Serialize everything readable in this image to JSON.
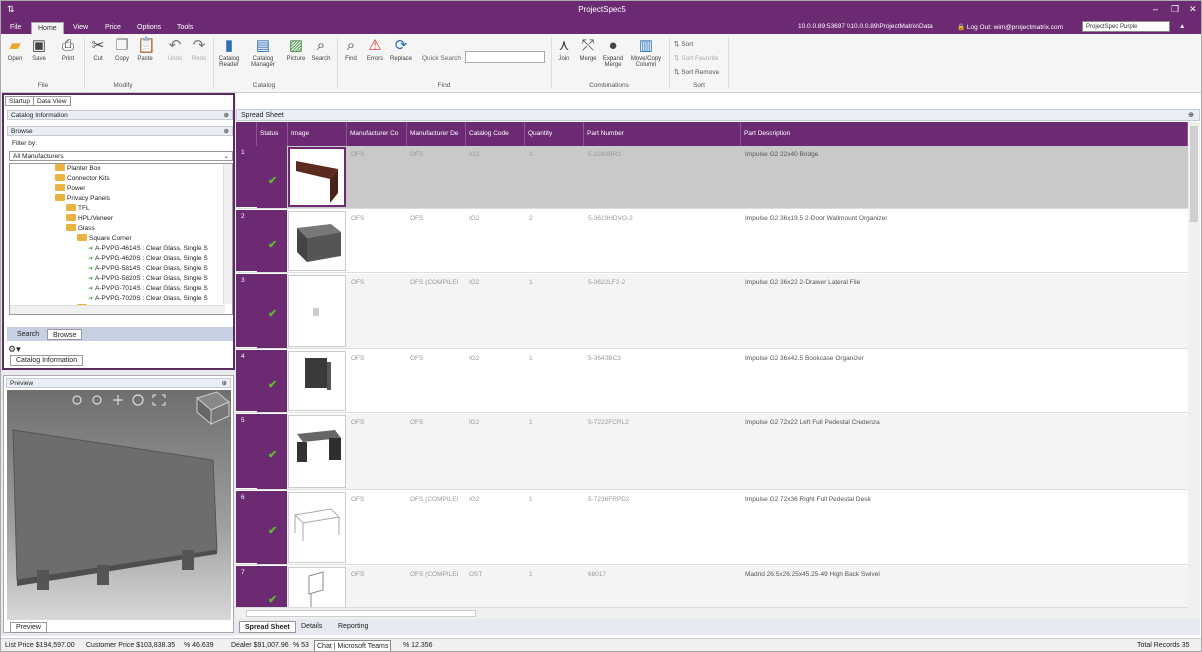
{
  "window": {
    "title": "ProjectSpec5"
  },
  "menu": {
    "tabs": [
      "File",
      "Home",
      "View",
      "Price",
      "Options",
      "Tools"
    ],
    "server": "10.0.0.89:53697  \\\\10.0.0.89\\ProjectMatrix\\Data",
    "logout": "Log Out: wim@projectmatrix.com",
    "theme": "ProjectSpec Purple"
  },
  "ribbon": {
    "file": {
      "open": "Open",
      "save": "Save",
      "print": "Print",
      "group": "File"
    },
    "modify": {
      "cut": "Cut",
      "copy": "Copy",
      "paste": "Paste",
      "undo": "Undo",
      "redo": "Redo",
      "group": "Modify"
    },
    "catalog": {
      "reader": "Catalog Reader",
      "manager": "Catalog Manager",
      "picture": "Picture",
      "search": "Search",
      "group": "Catalog"
    },
    "find": {
      "find": "Find",
      "errors": "Errors",
      "replace": "Replace",
      "quick_search": "Quick Search",
      "group": "Find"
    },
    "combinations": {
      "join": "Join",
      "merge": "Merge",
      "expand": "Expand Merge",
      "move": "Move/Copy Column",
      "group": "Combinations"
    },
    "sort": {
      "sort": "Sort",
      "favorite": "Sort Favorite",
      "remove": "Sort Remove",
      "group": "Sort"
    }
  },
  "left": {
    "tabs": [
      "Startup",
      "Data View"
    ],
    "catalog_info": "Catalog Information",
    "browse": "Browse",
    "filter_by": "Filter by:",
    "manufacturer": "All Manufacturers",
    "tree": [
      {
        "label": "Planter Box",
        "type": "folder",
        "level": 3
      },
      {
        "label": "Connector Kits",
        "type": "folder",
        "level": 3
      },
      {
        "label": "Power",
        "type": "folder",
        "level": 3
      },
      {
        "label": "Privacy Panels",
        "type": "folder",
        "level": 3
      },
      {
        "label": "TFL",
        "type": "folder",
        "level": 4
      },
      {
        "label": "HPL/Veneer",
        "type": "folder",
        "level": 4
      },
      {
        "label": "Glass",
        "type": "folder",
        "level": 4
      },
      {
        "label": "Square Corner",
        "type": "folder",
        "level": 5
      },
      {
        "label": "A-PVPG-4614S : Clear Glass, Single S",
        "type": "leaf",
        "level": 6
      },
      {
        "label": "A-PVPG-4620S : Clear Glass, Single S",
        "type": "leaf",
        "level": 6
      },
      {
        "label": "A-PVPG-5814S : Clear Glass, Single S",
        "type": "leaf",
        "level": 6
      },
      {
        "label": "A-PVPG-5820S : Clear Glass, Single S",
        "type": "leaf",
        "level": 6
      },
      {
        "label": "A-PVPG-7014S : Clear Glass, Single S",
        "type": "leaf",
        "level": 6
      },
      {
        "label": "A-PVPG-7020S : Clear Glass, Single S",
        "type": "leaf",
        "level": 6
      },
      {
        "label": "Round Corner",
        "type": "folder",
        "level": 5
      }
    ],
    "search_tab": "Search",
    "browse_tab": "Browse",
    "catinfo_tab": "Catalog Information",
    "preview": "Preview",
    "preview_tab": "Preview"
  },
  "sheet": {
    "title": "Spread Sheet",
    "columns": [
      "Status",
      "Image",
      "Manufacturer Co",
      "Manufacturer De",
      "Catalog Code",
      "Quantity",
      "Part Number",
      "Part Description"
    ],
    "rows": [
      {
        "n": "1",
        "mfr_code": "OFS",
        "mfr_desc": "OFS",
        "catalog": "IG2",
        "qty": "1",
        "part": "5-2240BR2",
        "desc": "Impulse G2 22x40 Bridge"
      },
      {
        "n": "2",
        "mfr_code": "OFS",
        "mfr_desc": "OFS",
        "catalog": "IG2",
        "qty": "2",
        "part": "5-3619HDVO-2",
        "desc": "Impulse G2 36x19.5 2-Door Wallmount Organizer"
      },
      {
        "n": "3",
        "mfr_code": "OFS",
        "mfr_desc": "OFS (COMPILEI",
        "catalog": "IG2",
        "qty": "1",
        "part": "5-3622LF2-2",
        "desc": "Impulse G2 36x22 2-Drawer Lateral File"
      },
      {
        "n": "4",
        "mfr_code": "OFS",
        "mfr_desc": "OFS",
        "catalog": "IG2",
        "qty": "1",
        "part": "5-3643BC3",
        "desc": "Impulse G2 36x42.5 Bookcase Organizer"
      },
      {
        "n": "5",
        "mfr_code": "OFS",
        "mfr_desc": "OFS",
        "catalog": "IG2",
        "qty": "1",
        "part": "5-7222FCRL2",
        "desc": "Impulse G2 72x22 Left Full Pedestal Credenza"
      },
      {
        "n": "6",
        "mfr_code": "OFS",
        "mfr_desc": "OFS (COMPILEI",
        "catalog": "IG2",
        "qty": "1",
        "part": "5-7236FRPD2",
        "desc": "Impulse G2 72x36 Right Full Pedestal Desk"
      },
      {
        "n": "7",
        "mfr_code": "OFS",
        "mfr_desc": "OFS (COMPILEI",
        "catalog": "OST",
        "qty": "1",
        "part": "68017",
        "desc": "Madrid 26.5x26.25x45.25-49 High Back Swivel"
      }
    ],
    "bottom_tabs": [
      "Spread Sheet",
      "Details",
      "Reporting"
    ]
  },
  "status": {
    "list_price": "List Price  $194,597.00",
    "customer_price": "Customer Price  $103,838.35",
    "customer_pct": "%  46.639",
    "dealer": "Dealer  $91,007.96",
    "dealer_pct": "%  53",
    "chat": "Chat | Microsoft Teams",
    "margin": "%  12.356",
    "total_records": "Total Records  35"
  }
}
